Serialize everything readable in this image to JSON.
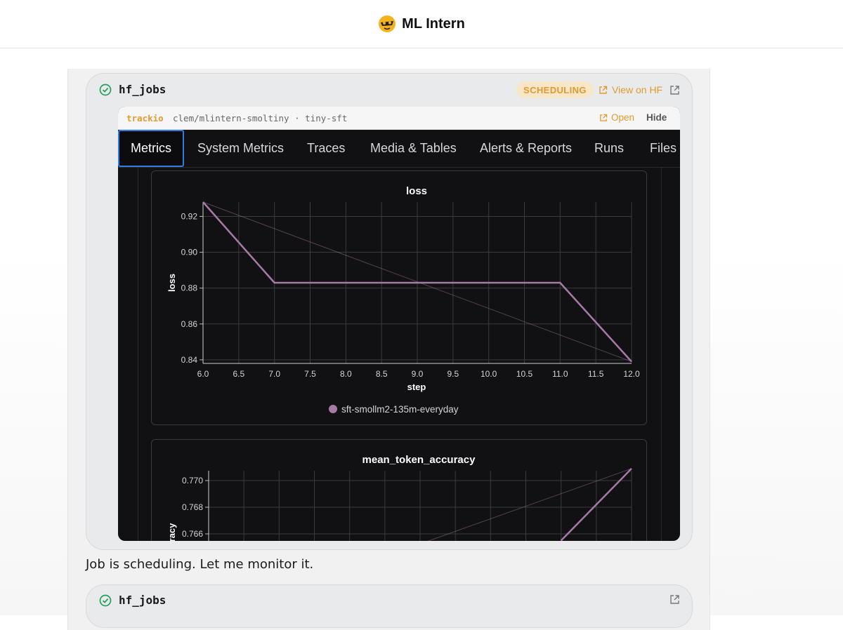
{
  "header": {
    "app_title": "ML Intern"
  },
  "tool_card_1": {
    "tool_name": "hf_jobs",
    "status_badge": "SCHEDULING",
    "view_link": "View on HF",
    "trackio_panel": {
      "brand": "trackio",
      "run_path": "clem/mlintern-smoltiny · tiny-sft",
      "open_link": "Open",
      "hide_link": "Hide",
      "tabs": [
        "Metrics",
        "System Metrics",
        "Traces",
        "Media & Tables",
        "Alerts & Reports",
        "Runs",
        "Files"
      ],
      "active_tab": "Metrics"
    }
  },
  "message": {
    "text": "Job is scheduling. Let me monitor it."
  },
  "tool_card_2": {
    "tool_name": "hf_jobs"
  },
  "colors": {
    "accent": "#e39a2d",
    "series": "#a77aa6",
    "panel_bg": "#111113",
    "success": "#22a05a"
  },
  "chart_data": [
    {
      "type": "line",
      "title": "loss",
      "xlabel": "step",
      "ylabel": "loss",
      "xlim": [
        6.0,
        12.0
      ],
      "ylim": [
        0.838,
        0.928
      ],
      "x_ticks": [
        "6.0",
        "6.5",
        "7.0",
        "7.5",
        "8.0",
        "8.5",
        "9.0",
        "9.5",
        "10.0",
        "10.5",
        "11.0",
        "11.5",
        "12.0"
      ],
      "y_ticks": [
        "0.84",
        "0.86",
        "0.88",
        "0.90",
        "0.92"
      ],
      "series": [
        {
          "name": "sft-smollm2-135m-everyday",
          "x": [
            6,
            7,
            11,
            12
          ],
          "y": [
            0.928,
            0.883,
            0.883,
            0.839
          ]
        }
      ],
      "trend_line": {
        "x": [
          6,
          12
        ],
        "y": [
          0.928,
          0.839
        ]
      },
      "legend": "bottom"
    },
    {
      "type": "line",
      "title": "mean_token_accuracy",
      "xlabel": "",
      "ylabel": "accuracy",
      "xlim": [
        6.0,
        12.0
      ],
      "y_ticks": [
        "0.770",
        "0.768",
        "0.766"
      ],
      "series": [
        {
          "name": "sft-smollm2-135m-everyday",
          "x": [
            11,
            12
          ],
          "y": [
            0.7655,
            0.7709
          ]
        }
      ],
      "trend_line": {
        "x": [
          6,
          12
        ],
        "y": [
          0.7596,
          0.7709
        ]
      }
    }
  ]
}
